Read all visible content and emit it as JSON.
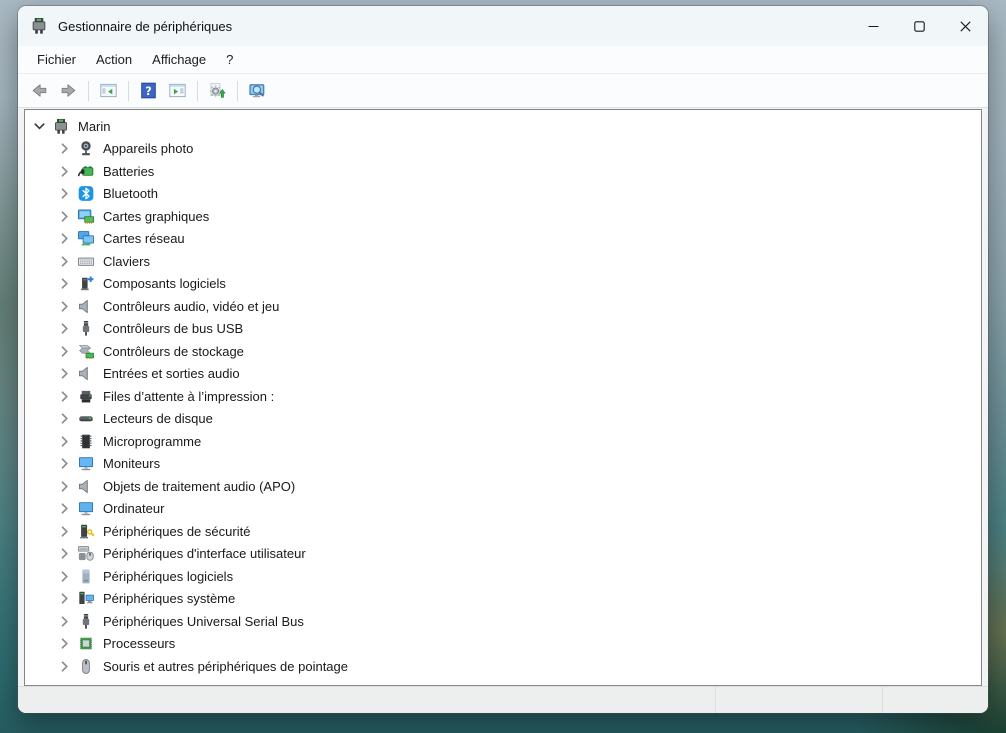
{
  "window": {
    "title": "Gestionnaire de périphériques",
    "controls": [
      "minimize",
      "maximize",
      "close"
    ]
  },
  "menu": {
    "items": [
      "Fichier",
      "Action",
      "Affichage",
      "?"
    ]
  },
  "toolbar": {
    "buttons": [
      {
        "name": "back",
        "icon": "back-arrow",
        "group": 1
      },
      {
        "name": "forward",
        "icon": "forward-arrow",
        "group": 1
      },
      {
        "name": "show-console-tree",
        "icon": "console-tree",
        "group": 2
      },
      {
        "name": "help",
        "icon": "help",
        "group": 3
      },
      {
        "name": "show-action-pane",
        "icon": "action-pane",
        "group": 3
      },
      {
        "name": "update-driver",
        "icon": "update-driver",
        "group": 4
      },
      {
        "name": "scan-hardware-changes",
        "icon": "scan-hardware",
        "group": 5
      }
    ]
  },
  "tree": {
    "root": {
      "label": "Marin",
      "icon": "device-manager",
      "state": "expanded"
    },
    "items": [
      {
        "label": "Appareils photo",
        "icon": "webcam"
      },
      {
        "label": "Batteries",
        "icon": "battery"
      },
      {
        "label": "Bluetooth",
        "icon": "bluetooth"
      },
      {
        "label": "Cartes graphiques",
        "icon": "display-adapter"
      },
      {
        "label": "Cartes réseau",
        "icon": "network-adapter"
      },
      {
        "label": "Claviers",
        "icon": "keyboard"
      },
      {
        "label": "Composants logiciels",
        "icon": "software-component"
      },
      {
        "label": "Contrôleurs audio, vidéo et jeu",
        "icon": "speaker"
      },
      {
        "label": "Contrôleurs de bus USB",
        "icon": "usb"
      },
      {
        "label": "Contrôleurs de stockage",
        "icon": "storage-controller"
      },
      {
        "label": "Entrées et sorties audio",
        "icon": "speaker"
      },
      {
        "label": "Files d’attente à l’impression :",
        "icon": "printer"
      },
      {
        "label": "Lecteurs de disque",
        "icon": "disk-drive"
      },
      {
        "label": "Microprogramme",
        "icon": "firmware-chip"
      },
      {
        "label": "Moniteurs",
        "icon": "monitor"
      },
      {
        "label": "Objets de traitement audio (APO)",
        "icon": "speaker"
      },
      {
        "label": "Ordinateur",
        "icon": "computer-monitor"
      },
      {
        "label": "Périphériques de sécurité",
        "icon": "security-device"
      },
      {
        "label": "Périphériques d'interface utilisateur",
        "icon": "hid-devices"
      },
      {
        "label": "Périphériques logiciels",
        "icon": "software-device"
      },
      {
        "label": "Périphériques système",
        "icon": "system-device"
      },
      {
        "label": "Périphériques Universal Serial Bus",
        "icon": "usb"
      },
      {
        "label": "Processeurs",
        "icon": "processor-chip"
      },
      {
        "label": "Souris et autres périphériques de pointage",
        "icon": "mouse"
      }
    ]
  },
  "statusbar": {
    "sections": [
      "",
      "",
      ""
    ]
  }
}
